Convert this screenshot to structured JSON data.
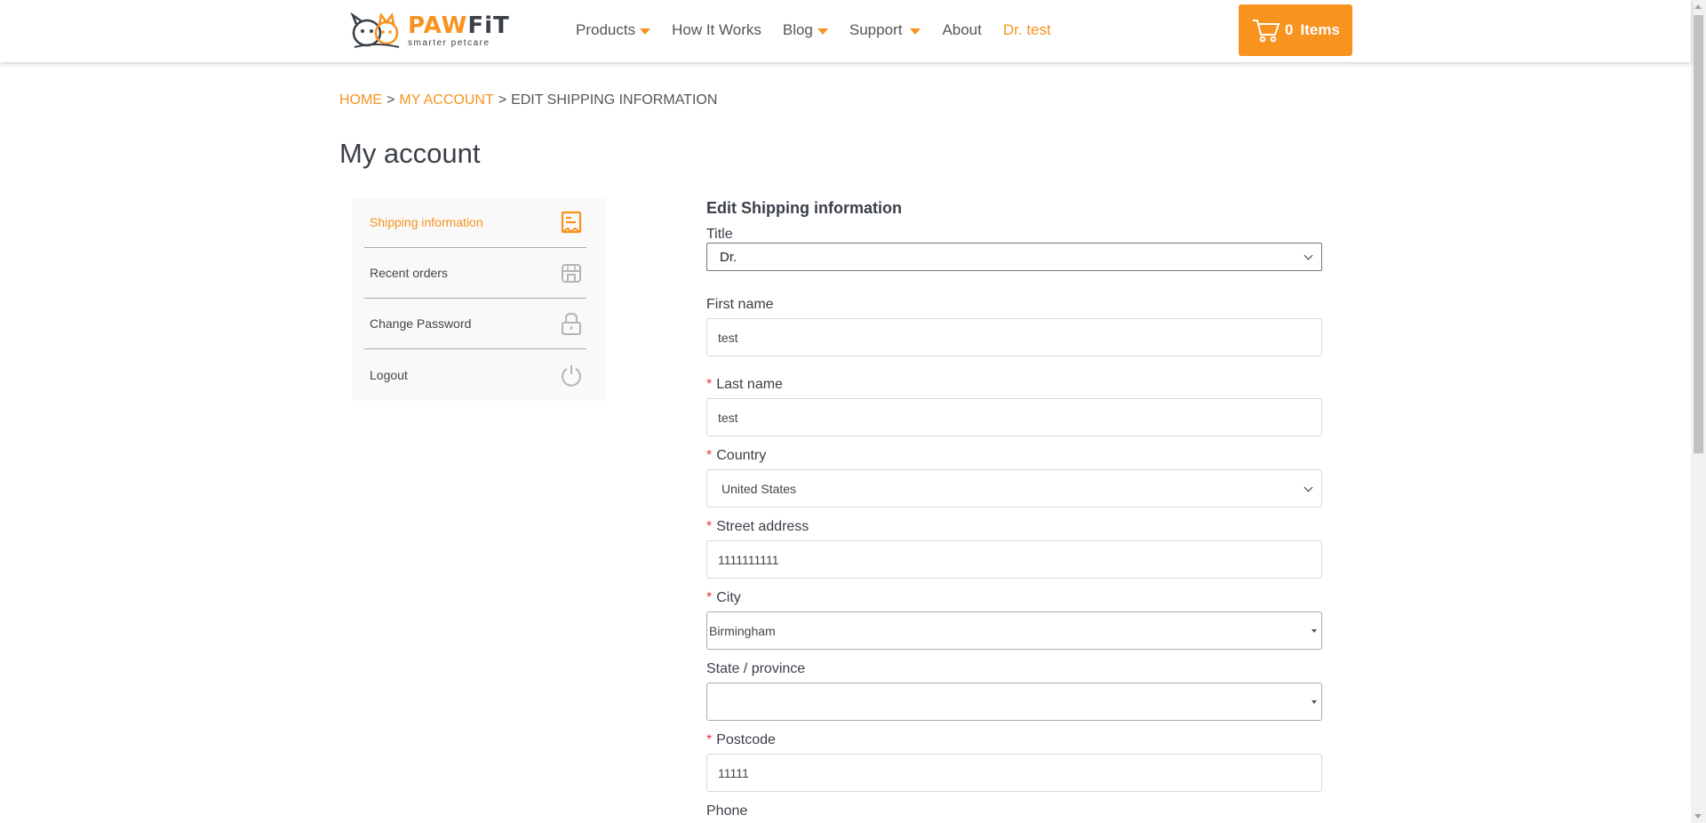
{
  "header": {
    "logo_word_1": "PAW",
    "logo_word_2": "FiT",
    "logo_tagline": "smarter petcare",
    "nav": [
      {
        "label": "Products",
        "dropdown": true
      },
      {
        "label": "How It Works",
        "dropdown": false
      },
      {
        "label": "Blog",
        "dropdown": true
      },
      {
        "label": "Support",
        "dropdown": true
      },
      {
        "label": "About",
        "dropdown": false
      },
      {
        "label": "Dr. test",
        "dropdown": false
      }
    ],
    "cart": {
      "count": "0",
      "label": "Items"
    }
  },
  "breadcrumb": {
    "home": "HOME",
    "sep": ">",
    "account": "MY ACCOUNT",
    "current": "EDIT SHIPPING INFORMATION"
  },
  "page_title": "My account",
  "sidebar": {
    "items": [
      {
        "label": "Shipping information",
        "icon": "receipt-icon",
        "active": true
      },
      {
        "label": "Recent orders",
        "icon": "store-icon",
        "active": false
      },
      {
        "label": "Change Password",
        "icon": "lock-icon",
        "active": false
      },
      {
        "label": "Logout",
        "icon": "power-icon",
        "active": false
      }
    ]
  },
  "form": {
    "title": "Edit Shipping information",
    "required_mark": "*",
    "title_field": {
      "label": "Title",
      "value": "Dr."
    },
    "first_name": {
      "label": "First name",
      "value": "test"
    },
    "last_name": {
      "label": "Last name",
      "value": "test"
    },
    "country": {
      "label": "Country",
      "value": "United States"
    },
    "street": {
      "label": "Street address",
      "value": "1111111111"
    },
    "city": {
      "label": "City",
      "value": "Birmingham"
    },
    "state": {
      "label": "State / province",
      "value": ""
    },
    "postcode": {
      "label": "Postcode",
      "value": "11111"
    },
    "phone": {
      "label": "Phone"
    }
  },
  "colors": {
    "accent": "#f7931e",
    "text": "#3a3f48",
    "required": "#e53935"
  }
}
